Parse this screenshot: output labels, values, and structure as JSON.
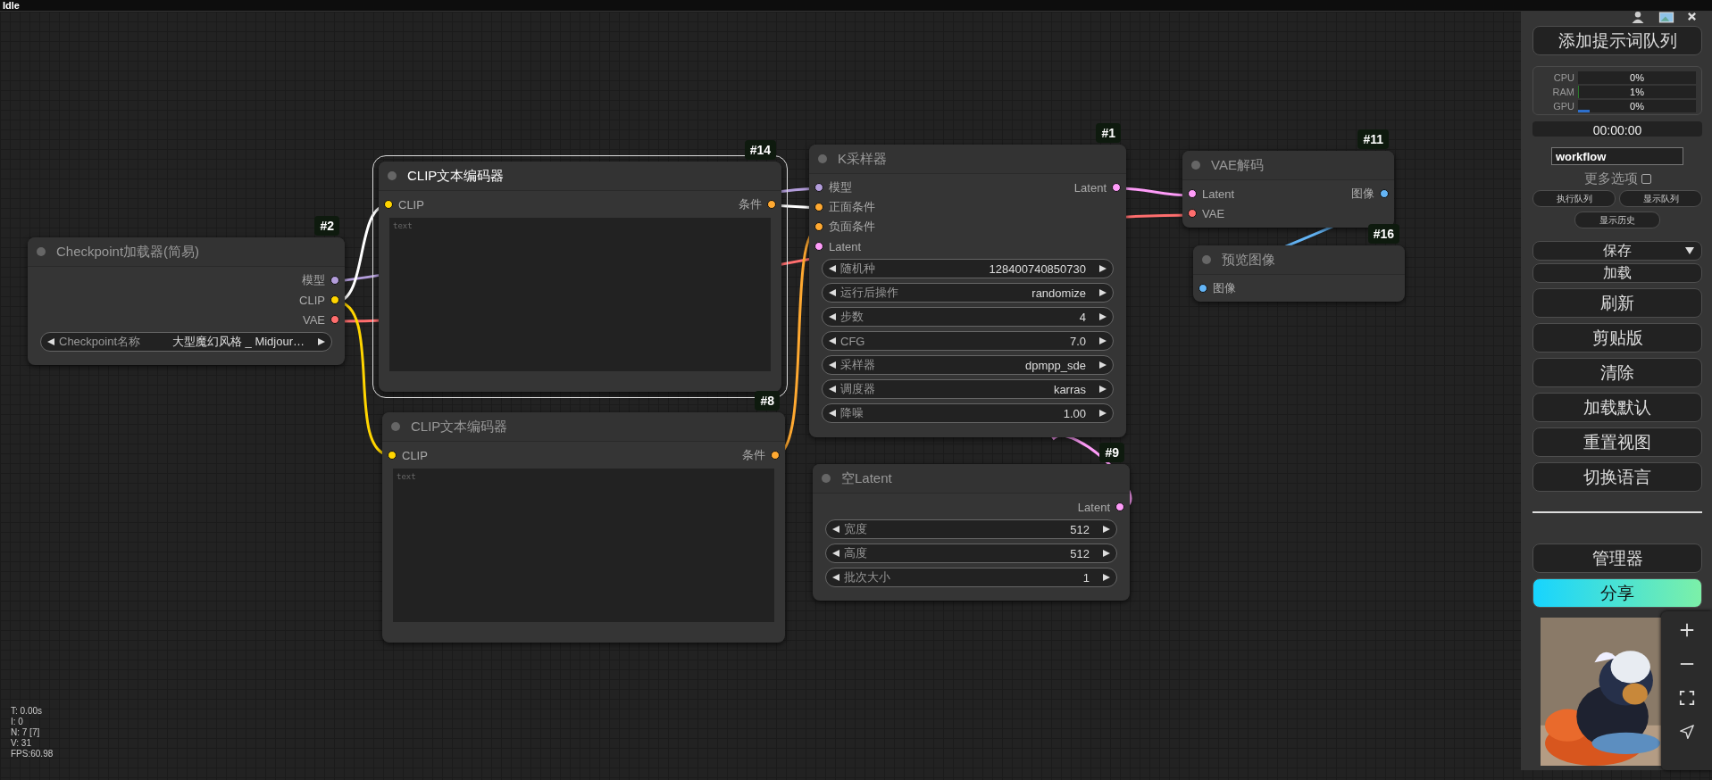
{
  "status_bar": {
    "text": "Idle"
  },
  "nodes": [
    {
      "badge": "#2",
      "title": "Checkpoint加载器(简易)",
      "selected": false,
      "outputs": [
        {
          "label": "模型",
          "color": "#b39ddb"
        },
        {
          "label": "CLIP",
          "color": "#ffd500"
        },
        {
          "label": "VAE",
          "color": "#ff6e6e"
        }
      ],
      "widgets": [
        {
          "label": "Checkpoint名称",
          "value": "大型魔幻风格 _ Midjour…"
        }
      ]
    },
    {
      "badge": "#14",
      "title": "CLIP文本编码器",
      "selected": true,
      "inputs": [
        {
          "label": "CLIP",
          "color": "#ffd500"
        }
      ],
      "outputs": [
        {
          "label": "条件",
          "color": "#ffa931"
        }
      ],
      "textarea": {
        "placeholder": "text"
      }
    },
    {
      "badge": "#8",
      "title": "CLIP文本编码器",
      "selected": false,
      "inputs": [
        {
          "label": "CLIP",
          "color": "#ffd500"
        }
      ],
      "outputs": [
        {
          "label": "条件",
          "color": "#ffa931"
        }
      ],
      "textarea": {
        "placeholder": "text"
      }
    },
    {
      "badge": "#1",
      "title": "K采样器",
      "selected": false,
      "inputs": [
        {
          "label": "模型",
          "color": "#b39ddb"
        },
        {
          "label": "正面条件",
          "color": "#ffa931"
        },
        {
          "label": "负面条件",
          "color": "#ffa931"
        },
        {
          "label": "Latent",
          "color": "#ff9cf9"
        }
      ],
      "outputs": [
        {
          "label": "Latent",
          "color": "#ff9cf9"
        }
      ],
      "widgets": [
        {
          "label": "随机种",
          "value": "128400740850730"
        },
        {
          "label": "运行后操作",
          "value": "randomize"
        },
        {
          "label": "步数",
          "value": "4"
        },
        {
          "label": "CFG",
          "value": "7.0"
        },
        {
          "label": "采样器",
          "value": "dpmpp_sde"
        },
        {
          "label": "调度器",
          "value": "karras"
        },
        {
          "label": "降噪",
          "value": "1.00"
        }
      ]
    },
    {
      "badge": "#9",
      "title": "空Latent",
      "selected": false,
      "outputs": [
        {
          "label": "Latent",
          "color": "#ff9cf9"
        }
      ],
      "widgets": [
        {
          "label": "宽度",
          "value": "512"
        },
        {
          "label": "高度",
          "value": "512"
        },
        {
          "label": "批次大小",
          "value": "1"
        }
      ]
    },
    {
      "badge": "#11",
      "title": "VAE解码",
      "selected": false,
      "inputs": [
        {
          "label": "Latent",
          "color": "#ff9cf9"
        },
        {
          "label": "VAE",
          "color": "#ff6e6e"
        }
      ],
      "outputs": [
        {
          "label": "图像",
          "color": "#64b5f6"
        }
      ]
    },
    {
      "badge": "#16",
      "title": "预览图像",
      "selected": false,
      "inputs": [
        {
          "label": "图像",
          "color": "#64b5f6"
        }
      ]
    }
  ],
  "canvas_info": [
    "T: 0.00s",
    "I: 0",
    "N: 7 [7]",
    "V: 31",
    "FPS:60.98"
  ],
  "panel": {
    "queue_button": "添加提示词队列",
    "stats": [
      {
        "label": "CPU",
        "value": "0%"
      },
      {
        "label": "RAM",
        "value": "1%",
        "level": 0.01
      },
      {
        "label": "GPU",
        "value": "0%",
        "level": 0.1
      }
    ],
    "timer": "00:00:00",
    "workflow_field": {
      "value": "workflow"
    },
    "more_options": {
      "label": "更多选项",
      "checked": false
    },
    "queue_buttons": [
      "执行队列",
      "显示队列"
    ],
    "history_button": "显示历史",
    "save_dropdown": "保存",
    "buttons": [
      "加载",
      "刷新",
      "剪贴版",
      "清除",
      "加载默认",
      "重置视图",
      "切换语言"
    ],
    "manager_button": "管理器",
    "share_button": "分享"
  }
}
